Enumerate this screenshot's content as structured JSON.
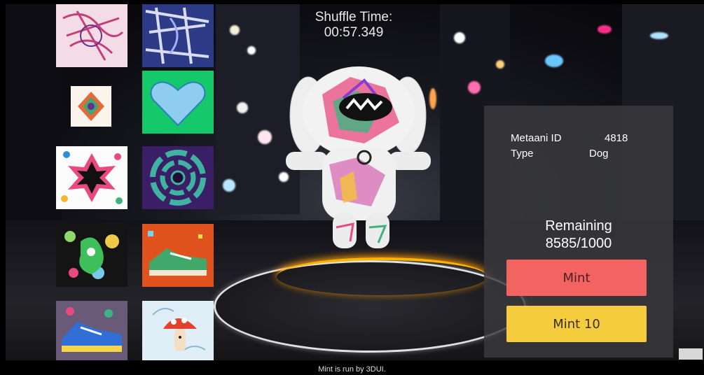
{
  "shuffle": {
    "label": "Shuffle Time:",
    "time": "00:57.349"
  },
  "panel": {
    "id_label": "Metaani ID",
    "id_value": "4818",
    "type_label": "Type",
    "type_value": "Dog",
    "remaining_label": "Remaining",
    "remaining_value": "8585/1000"
  },
  "buttons": {
    "mint": "Mint",
    "mint10": "Mint 10"
  },
  "footer": "Mint is run by 3DUI.",
  "colors": {
    "mint": "#f36362",
    "mint10": "#f4cc3e",
    "panel": "#3a3a3e",
    "accent_ring": "#ffb400"
  },
  "nft_cards": [
    {
      "icon": "abstract-pink-art"
    },
    {
      "icon": "abstract-blue-art"
    },
    {
      "icon": "geometric-pendant-art"
    },
    {
      "icon": "heart-art"
    },
    {
      "icon": "dotted-star-art"
    },
    {
      "icon": "concentric-rings-art"
    },
    {
      "icon": "green-bubble-art"
    },
    {
      "icon": "sneaker-orange-art"
    },
    {
      "icon": "blue-sneaker-art"
    },
    {
      "icon": "mushroom-art"
    }
  ]
}
